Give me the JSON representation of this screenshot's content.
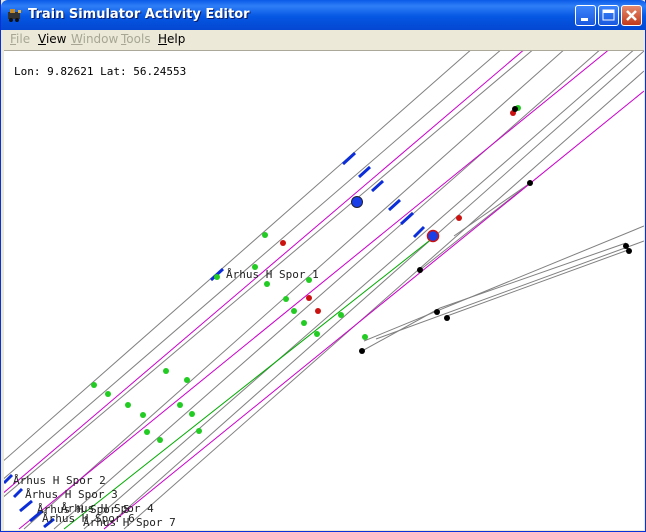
{
  "window": {
    "title": "Train Simulator Activity Editor",
    "title_icon": "train-app-icon",
    "controls": [
      "minimize",
      "maximize",
      "close"
    ]
  },
  "menu": {
    "file": "File",
    "view": "View",
    "window": "Window",
    "tools": "Tools",
    "help": "Help"
  },
  "status": {
    "coords": "Lon: 9.82621 Lat: 56.24553"
  },
  "map": {
    "track_labels": {
      "spor1": "Århus H  Spor 1",
      "spor2": "Århus H Spor 2",
      "spor3": "Århus H Spor 3",
      "spor4": "Århus H Spor 4",
      "spor5": "Århus H Spor 5",
      "spor6": "Århus H Spor 6",
      "spor7": "Århus H Spor 7"
    },
    "colors": {
      "track_gray": "#808080",
      "path_magenta": "#cc00cc",
      "path_green": "#00aa00",
      "node_green": "#22cc22",
      "node_red": "#cc1111",
      "node_black": "#000000",
      "platform_blue": "#0b2ed8"
    }
  }
}
